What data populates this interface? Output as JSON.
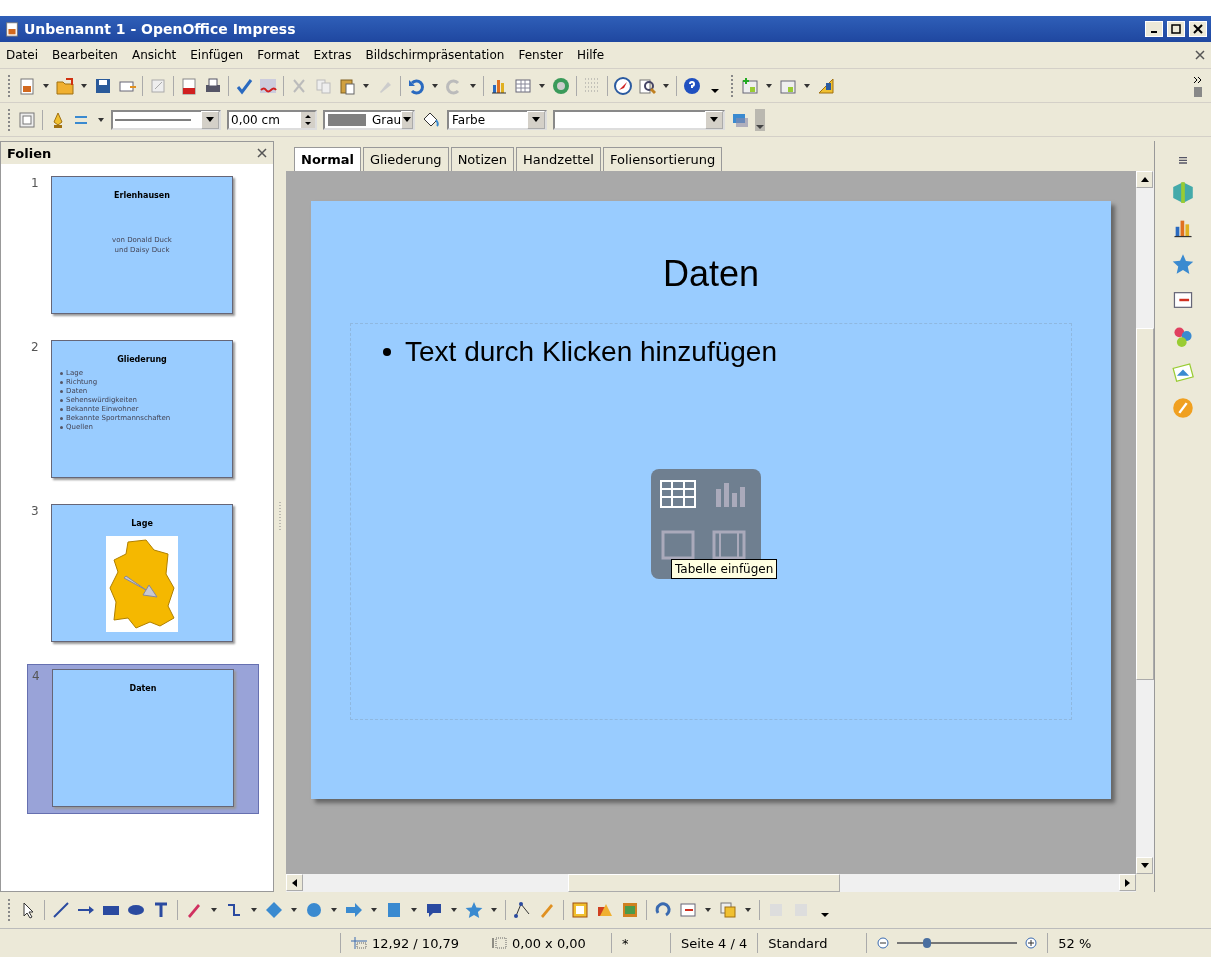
{
  "window": {
    "title": "Unbenannt 1 - OpenOffice Impress"
  },
  "menu": [
    "Datei",
    "Bearbeiten",
    "Ansicht",
    "Einfügen",
    "Format",
    "Extras",
    "Bildschirmpräsentation",
    "Fenster",
    "Hilfe"
  ],
  "line_toolbar": {
    "line_width": "0,00 cm",
    "line_color": "Grau",
    "area_style": "Farbe"
  },
  "slides_pane": {
    "title": "Folien",
    "slides": [
      {
        "number": "1",
        "kind": "title",
        "title": "Erlenhausen",
        "lines": [
          "von Donald Duck",
          "und Daisy Duck"
        ],
        "selected": false
      },
      {
        "number": "2",
        "kind": "bullets",
        "title": "Gliederung",
        "lines": [
          "Lage",
          "Richtung",
          "Daten",
          "Sehenswürdigkeiten",
          "Bekannte Einwohner",
          "Bekannte Sportmannschaften",
          "Quellen"
        ],
        "selected": false
      },
      {
        "number": "3",
        "kind": "picture",
        "title": "Lage",
        "selected": false
      },
      {
        "number": "4",
        "kind": "title",
        "title": "Daten",
        "selected": true
      }
    ]
  },
  "view_tabs": [
    {
      "label": "Normal",
      "selected": true
    },
    {
      "label": "Gliederung",
      "selected": false
    },
    {
      "label": "Notizen",
      "selected": false
    },
    {
      "label": "Handzettel",
      "selected": false
    },
    {
      "label": "Foliensortierung",
      "selected": false
    }
  ],
  "slide": {
    "title": "Daten",
    "outline_placeholder": "Text durch Klicken hinzufügen",
    "tooltip": "Tabelle einfügen"
  },
  "status_bar": {
    "position": "12,92 / 10,79",
    "size": "0,00 x 0,00",
    "modified": "*",
    "page": "Seite 4 / 4",
    "layout": "Standard",
    "zoom": {
      "level": 0.25
    },
    "zoom_percent": "52 %"
  }
}
